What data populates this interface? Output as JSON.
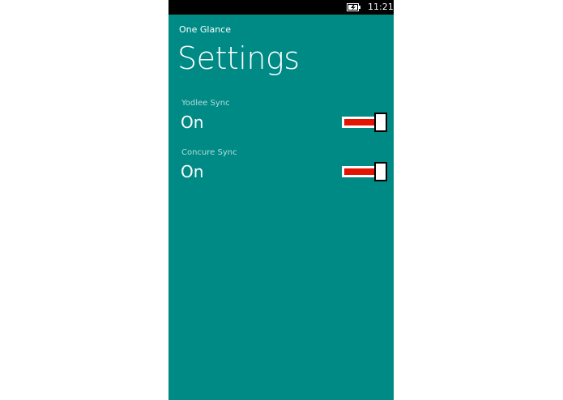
{
  "status_bar": {
    "battery_icon": "battery-charging-icon",
    "time": "11:21"
  },
  "header": {
    "app_name": "One Glance",
    "title": "Settings"
  },
  "settings": [
    {
      "label": "Yodlee Sync",
      "value": "On",
      "enabled": true
    },
    {
      "label": "Concure Sync",
      "value": "On",
      "enabled": true
    }
  ],
  "colors": {
    "background": "#008a85",
    "toggle_fill": "#e51400",
    "status_bar": "#000000",
    "label": "#b3dcda",
    "text": "#ffffff"
  }
}
